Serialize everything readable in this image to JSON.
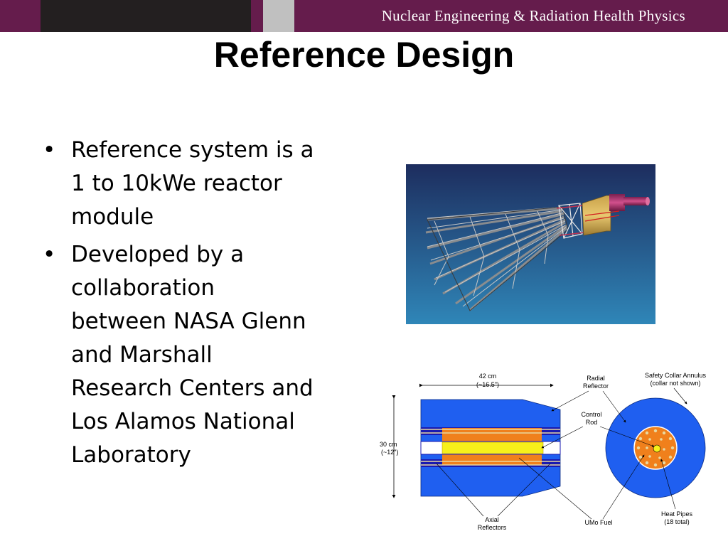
{
  "header": {
    "department": "Nuclear Engineering & Radiation Health Physics",
    "colors": {
      "banner": "#651c4c",
      "dark_block": "#231f20",
      "grey_block": "#c0c0c0"
    }
  },
  "slide": {
    "title": "Reference Design",
    "bullets": [
      {
        "marker": "•",
        "lines": [
          "Reference system is a",
          "1 to 10kWe reactor",
          "module"
        ]
      },
      {
        "marker": "•",
        "lines": [
          "Developed by a",
          "collaboration",
          "between NASA Glenn",
          "and Marshall",
          "Research Centers and",
          "Los Alamos National",
          "Laboratory"
        ]
      }
    ]
  },
  "diagram": {
    "length_label": [
      "42 cm",
      "(~16.5\")"
    ],
    "height_label": [
      "30 cm",
      "(~12\")"
    ],
    "radial_reflector": [
      "Radial",
      "Reflector"
    ],
    "control_rod": [
      "Control",
      "Rod"
    ],
    "safety_collar": [
      "Safety Collar Annulus",
      "(collar not shown)"
    ],
    "axial_reflectors": [
      "Axial",
      "Reflectors"
    ],
    "umo_fuel": "UMo Fuel",
    "heat_pipes": [
      "Heat Pipes",
      "(18 total)"
    ],
    "colors": {
      "reflector": "#1f5ff0",
      "fuel": "#f0801c",
      "control_rod": "#f7f01a",
      "heat_pipe": "#e8d8a0"
    }
  }
}
